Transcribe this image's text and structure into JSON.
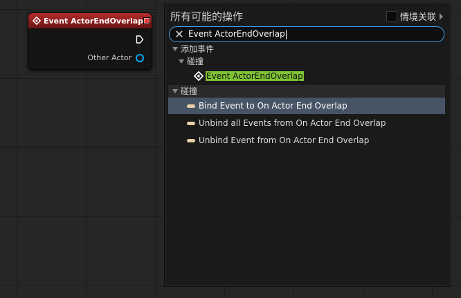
{
  "node": {
    "title": "Event ActorEndOverlap",
    "output_pin_label": "Other Actor"
  },
  "menu": {
    "title": "所有可能的操作",
    "context_label": "情境关联",
    "context_checked": false,
    "search": {
      "value": "Event ActorEndOverlap"
    },
    "tree": {
      "add_event_label": "添加事件",
      "collision_label": "碰撞",
      "event_item_label": "Event ActorEndOverlap",
      "collision_category_label": "碰撞",
      "actions": [
        {
          "label": "Bind Event to On Actor End Overlap",
          "selected": true
        },
        {
          "label": "Unbind all Events from On Actor End Overlap",
          "selected": false
        },
        {
          "label": "Unbind Event from On Actor End Overlap",
          "selected": false
        }
      ]
    }
  },
  "colors": {
    "node_header": "#b42b2b",
    "highlight": "#7fc233",
    "selection": "#475466",
    "search_border": "#3fa0e8",
    "object_pin": "#00a8f0"
  }
}
